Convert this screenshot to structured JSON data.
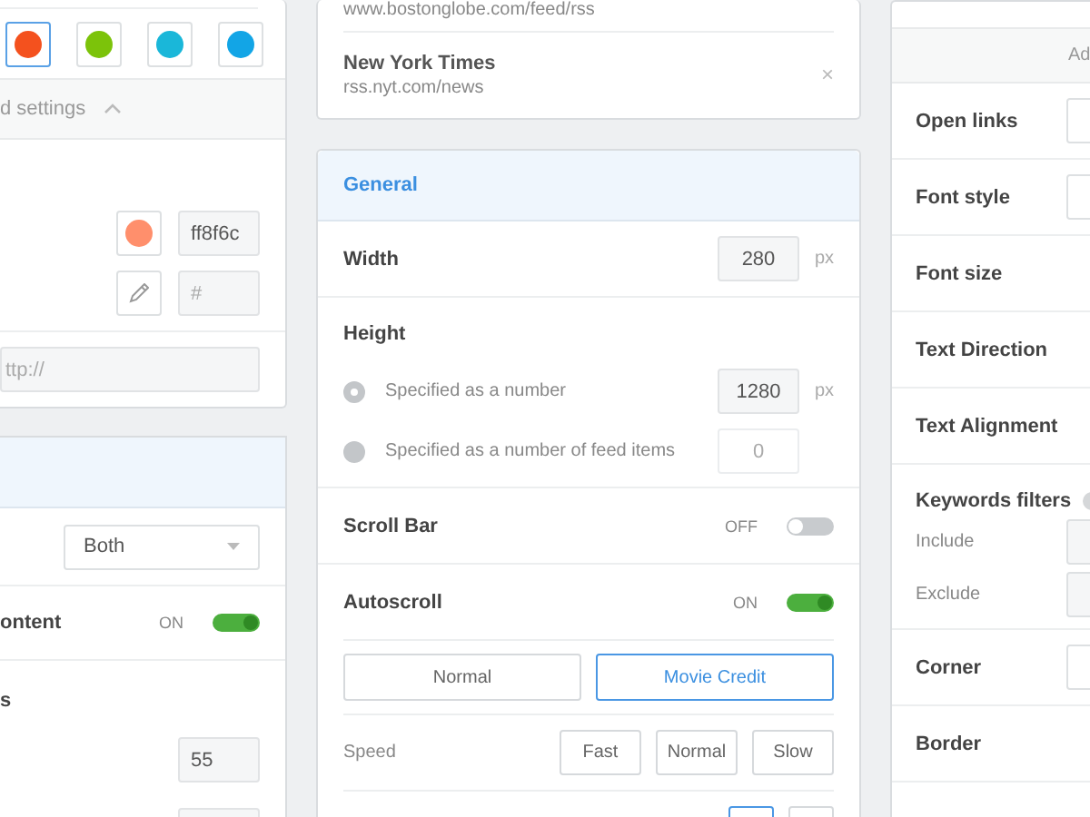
{
  "left": {
    "swatches": [
      {
        "color": "#f4511e",
        "selected": true
      },
      {
        "color": "#7cc30a",
        "selected": false
      },
      {
        "color": "#1ab7d9",
        "selected": false
      },
      {
        "color": "#12a5e6",
        "selected": false
      }
    ],
    "advanced": {
      "label": "d settings",
      "expanded": true
    },
    "custom_color": {
      "color": "#ff8f6c",
      "value": "ff8f6c"
    },
    "custom_hex": {
      "placeholder": "#"
    },
    "url_field": {
      "placeholder": "ttp://"
    },
    "select": {
      "value": "Both"
    },
    "content_row": {
      "label": "ontent",
      "state_label": "ON",
      "on": true
    },
    "section_label": "s",
    "fields": [
      "55"
    ]
  },
  "feeds": [
    {
      "url": "www.bostonglobe.com/feed/rss"
    },
    {
      "name": "New York Times",
      "url": "rss.nyt.com/news",
      "remove": "×"
    }
  ],
  "general": {
    "title": "General",
    "width": {
      "label": "Width",
      "value": "280",
      "unit": "px"
    },
    "height": {
      "label": "Height",
      "options": [
        {
          "label": "Specified as a number",
          "value": "1280",
          "unit": "px",
          "selected": true,
          "disabled": false
        },
        {
          "label": "Specified as a number of feed items",
          "placeholder": "0",
          "selected": false,
          "disabled": true
        }
      ]
    },
    "toggles": [
      {
        "label": "Scroll Bar",
        "state_label": "OFF",
        "on": false
      },
      {
        "label": "Autoscroll",
        "state_label": "ON",
        "on": true
      }
    ],
    "modes": [
      {
        "label": "Normal",
        "selected": false
      },
      {
        "label": "Movie Credit",
        "selected": true
      }
    ],
    "speed": {
      "label": "Speed",
      "options": [
        {
          "label": "Fast"
        },
        {
          "label": "Normal"
        },
        {
          "label": "Slow"
        }
      ]
    }
  },
  "right": {
    "header": "Ad",
    "rows": [
      {
        "kind": "field",
        "label": "Open links"
      },
      {
        "kind": "field",
        "label": "Font style"
      },
      {
        "kind": "plain",
        "label": "Font size"
      },
      {
        "kind": "plain",
        "label": "Text Direction"
      },
      {
        "kind": "plain",
        "label": "Text Alignment"
      },
      {
        "kind": "keywords",
        "label": "Keywords filters",
        "filters": [
          "Include",
          "Exclude"
        ]
      },
      {
        "kind": "field",
        "label": "Corner"
      },
      {
        "kind": "plain",
        "label": "Border"
      }
    ]
  }
}
